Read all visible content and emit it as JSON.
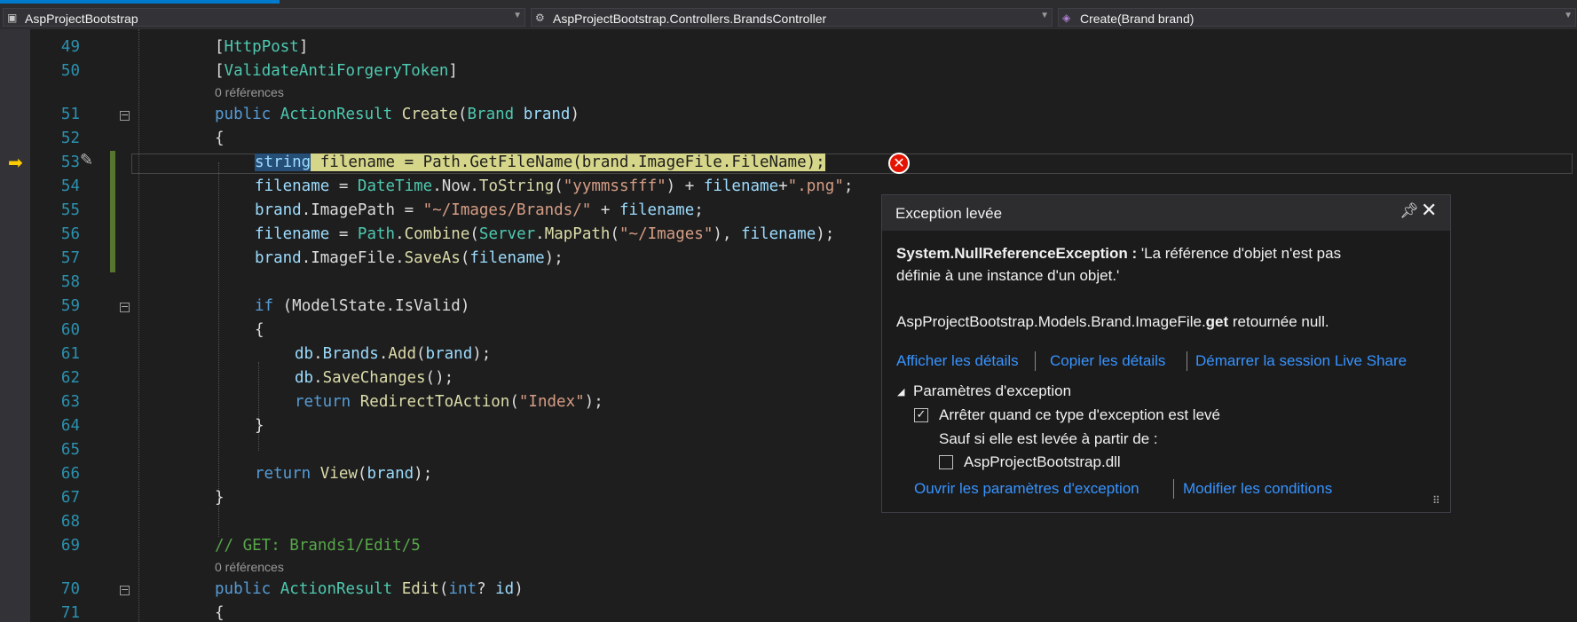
{
  "navbar": {
    "project": "AspProjectBootstrap",
    "class_path": "AspProjectBootstrap.Controllers.BrandsController",
    "member": "Create(Brand brand)"
  },
  "code": {
    "line_numbers": [
      "49",
      "50",
      "51",
      "52",
      "53",
      "54",
      "55",
      "56",
      "57",
      "58",
      "59",
      "60",
      "61",
      "62",
      "63",
      "64",
      "65",
      "66",
      "67",
      "68",
      "69",
      "70",
      "71"
    ],
    "lens_references": "0 références",
    "l49": [
      "[",
      "HttpPost",
      "]"
    ],
    "l50": [
      "[",
      "ValidateAntiForgeryToken",
      "]"
    ],
    "l51": [
      "public",
      " ",
      "ActionResult",
      " ",
      "Create",
      "(",
      "Brand",
      " ",
      "brand",
      ")"
    ],
    "brace_open": "{",
    "brace_close": "}",
    "l53": [
      "string",
      " filename = Path.GetFileName(brand.ImageFile.FileName);"
    ],
    "l54": [
      "filename",
      " = ",
      "DateTime",
      ".",
      "Now",
      ".",
      "ToString",
      "(",
      "\"yymmssfff\"",
      ") + ",
      "filename",
      "+",
      "\".png\"",
      ";"
    ],
    "l55": [
      "brand",
      ".",
      "ImagePath",
      " = ",
      "\"~/Images/Brands/\"",
      " + ",
      "filename",
      ";"
    ],
    "l56": [
      "filename",
      " = ",
      "Path",
      ".",
      "Combine",
      "(",
      "Server",
      ".",
      "MapPath",
      "(",
      "\"~/Images\"",
      "), ",
      "filename",
      ");"
    ],
    "l57": [
      "brand",
      ".",
      "ImageFile",
      ".",
      "SaveAs",
      "(",
      "filename",
      ");"
    ],
    "l59": [
      "if",
      " (",
      "ModelState",
      ".",
      "IsValid",
      ")"
    ],
    "l61": [
      "db",
      ".",
      "Brands",
      ".",
      "Add",
      "(",
      "brand",
      ");"
    ],
    "l62": [
      "db",
      ".",
      "SaveChanges",
      "();"
    ],
    "l63": [
      "return",
      " ",
      "RedirectToAction",
      "(",
      "\"Index\"",
      ");"
    ],
    "l66": [
      "return",
      " ",
      "View",
      "(",
      "brand",
      ");"
    ],
    "l69": "// GET: Brands1/Edit/5",
    "l70": [
      "public",
      " ",
      "ActionResult",
      " ",
      "Edit",
      "(",
      "int",
      "? ",
      "id",
      ")"
    ]
  },
  "exception_popup": {
    "title": "Exception levée",
    "exception_type": "System.NullReferenceException :",
    "message_1": " 'La référence d'objet n'est pas",
    "message_2": "définie à une instance d'un objet.'",
    "detail_prefix": "AspProjectBootstrap.Models.Brand.ImageFile.",
    "detail_bold": "get",
    "detail_suffix": " retournée null.",
    "link_details": "Afficher les détails",
    "link_copy": "Copier les détails",
    "link_liveshare": "Démarrer la session Live Share",
    "section_title": "Paramètres d'exception",
    "break_checkbox_label": "Arrêter quand ce type d'exception est levé",
    "break_checked": true,
    "except_label": "Sauf si elle est levée à partir de :",
    "dll_checkbox_label": "AspProjectBootstrap.dll",
    "dll_checked": false,
    "link_open_settings": "Ouvrir les paramètres d'exception",
    "link_edit_conditions": "Modifier les conditions"
  },
  "icons": {
    "pin": "pin-icon",
    "close": "close-icon",
    "error": "error-icon",
    "exec": "execution-pointer-icon",
    "pencil": "edit-and-continue-icon"
  },
  "colors": {
    "keyword": "#569cd6",
    "type": "#4ec9b0",
    "method": "#dcdcaa",
    "string": "#d69d85",
    "identifier": "#9cdcfe",
    "comment": "#57a64a",
    "line_number": "#2b91af",
    "link": "#3794ff",
    "error": "#e51400"
  }
}
